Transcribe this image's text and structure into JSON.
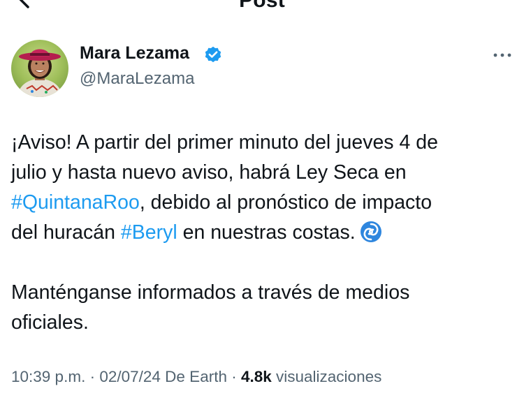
{
  "header": {
    "title": "Post",
    "back_icon": "back-arrow-icon"
  },
  "author": {
    "name": "Mara Lezama",
    "handle": "@MaraLezama",
    "verified_icon": "verified-badge-icon",
    "verified_color": "#1d9bf0",
    "more_icon": "more-options-icon"
  },
  "tweet": {
    "line_1a": "¡Aviso! A partir del primer minuto del jueves 4 de",
    "line_1b": "julio y hasta nuevo aviso, habrá Ley Seca en",
    "hashtag_1": "#QuintanaRoo",
    "line_1c": ", debido al pronóstico de impacto",
    "line_1d": "del huracán ",
    "hashtag_2": "#Beryl",
    "line_1e": " en nuestras costas.",
    "emoji_icon": "cyclone-icon",
    "paragraph_2a": "Manténganse informados a través de medios",
    "paragraph_2b": "oficiales.",
    "hashtag_color": "#1d9bf0"
  },
  "meta": {
    "time": "10:39 p.m.",
    "sep_1": " · ",
    "date": "02/07/24",
    "source": " De Earth",
    "sep_2": " · ",
    "views_count": "4.8k",
    "views_label": " visualizaciones"
  }
}
